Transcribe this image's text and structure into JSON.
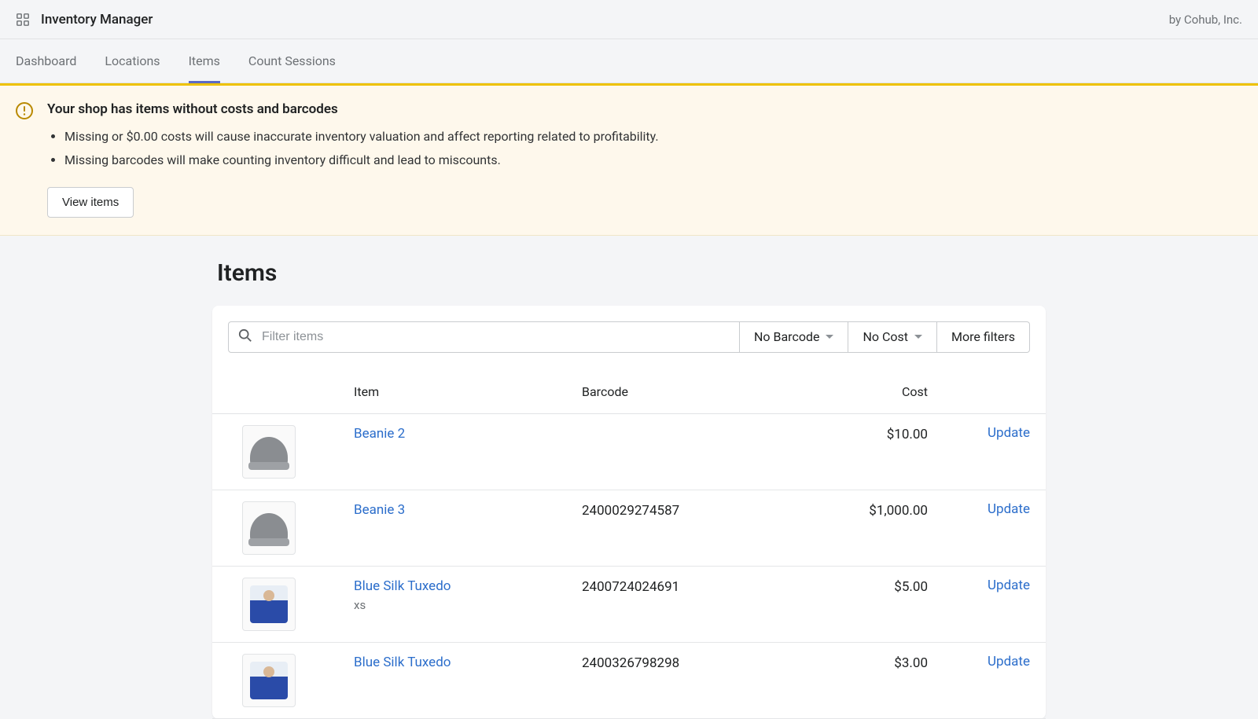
{
  "header": {
    "app_title": "Inventory Manager",
    "byline": "by Cohub, Inc."
  },
  "nav": {
    "items": [
      "Dashboard",
      "Locations",
      "Items",
      "Count Sessions"
    ],
    "active_index": 2
  },
  "banner": {
    "title": "Your shop has items without costs and barcodes",
    "bullets": [
      "Missing or $0.00 costs will cause inaccurate inventory valuation and affect reporting related to profitability.",
      "Missing barcodes will make counting inventory difficult and lead to miscounts."
    ],
    "button": "View items"
  },
  "page": {
    "title": "Items"
  },
  "filters": {
    "search_placeholder": "Filter items",
    "no_barcode": "No Barcode",
    "no_cost": "No Cost",
    "more": "More filters"
  },
  "table": {
    "columns": {
      "item": "Item",
      "barcode": "Barcode",
      "cost": "Cost"
    },
    "action_label": "Update",
    "rows": [
      {
        "name": "Beanie 2",
        "variant": "",
        "barcode": "",
        "cost": "$10.00",
        "thumb": "beanie"
      },
      {
        "name": "Beanie 3",
        "variant": "",
        "barcode": "2400029274587",
        "cost": "$1,000.00",
        "thumb": "beanie"
      },
      {
        "name": "Blue Silk Tuxedo",
        "variant": "xs",
        "barcode": "2400724024691",
        "cost": "$5.00",
        "thumb": "tux"
      },
      {
        "name": "Blue Silk Tuxedo",
        "variant": "",
        "barcode": "2400326798298",
        "cost": "$3.00",
        "thumb": "tux"
      }
    ]
  }
}
